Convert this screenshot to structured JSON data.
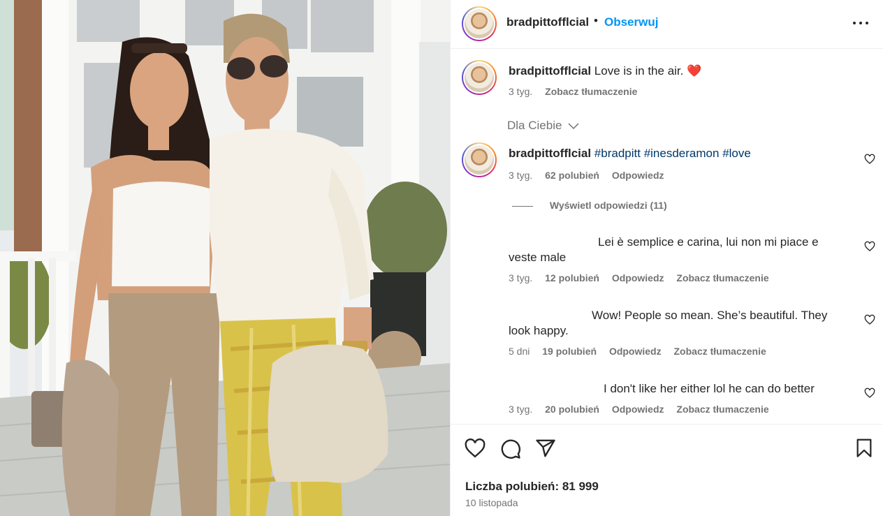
{
  "post": {
    "username": "bradpittofflcial",
    "follow_label": "Obserwuj",
    "dot": "•"
  },
  "caption": {
    "username": "bradpittofflcial",
    "text": "Love is in the air.",
    "emoji": "❤️",
    "age": "3 tyg.",
    "translate": "Zobacz tłumaczenie"
  },
  "filter": {
    "label": "Dla Ciebie"
  },
  "comments": [
    {
      "username": "bradpittofflcial",
      "tags": [
        "#bradpitt",
        "#inesderamon",
        "#love"
      ],
      "age": "3 tyg.",
      "likes": "62 polubień",
      "reply": "Odpowiedz",
      "view_replies": "Wyświetl odpowiedzi (11)"
    },
    {
      "text_line1": "Lei è semplice e carina, lui non mi piace e",
      "text_line2": "veste male",
      "age": "3 tyg.",
      "likes": "12 polubień",
      "reply": "Odpowiedz",
      "translate": "Zobacz tłumaczenie"
    },
    {
      "text_line1": "Wow! People so mean. She’s beautiful. They",
      "text_line2": "look happy.",
      "age": "5 dni",
      "likes": "19 polubień",
      "reply": "Odpowiedz",
      "translate": "Zobacz tłumaczenie"
    },
    {
      "text_line1": "I don't like her either lol he can do better",
      "age": "3 tyg.",
      "likes": "20 polubień",
      "reply": "Odpowiedz",
      "translate": "Zobacz tłumaczenie"
    }
  ],
  "footer": {
    "likes": "Liczba polubień: 81 999",
    "date": "10 listopada"
  },
  "icons": {
    "like": "heart-icon",
    "comment": "comment-icon",
    "share": "send-icon",
    "save": "bookmark-icon",
    "more": "more-icon"
  },
  "colors": {
    "accent": "#0095f6",
    "hashtag": "#00376b",
    "secondary": "#737373",
    "heart_emoji": "#ed1b2f"
  }
}
